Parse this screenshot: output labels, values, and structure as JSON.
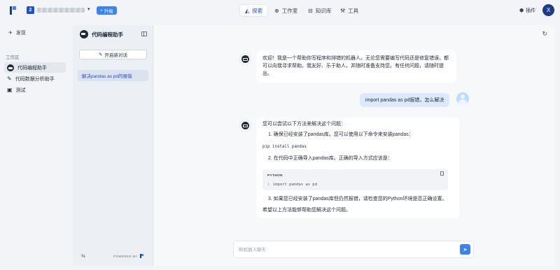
{
  "topbar": {
    "workspace_badge": "2",
    "upgrade_label": "升级",
    "tabs": [
      {
        "label": "探索",
        "icon": "explore-icon",
        "active": true
      },
      {
        "label": "工作室",
        "icon": "studio-icon",
        "active": false
      },
      {
        "label": "知识库",
        "icon": "knowledge-icon",
        "active": false
      },
      {
        "label": "工具",
        "icon": "tools-icon",
        "active": false
      }
    ],
    "plugin_label": "插件",
    "avatar_letter": "X"
  },
  "sidebar": {
    "discover_label": "发现",
    "section_label": "工作区",
    "items": [
      {
        "label": "代码编程助手",
        "active": true
      },
      {
        "label": "代码数据分析助手",
        "active": false
      },
      {
        "label": "测试",
        "active": false
      }
    ]
  },
  "panel": {
    "title": "代码编程助手",
    "new_chat_label": "开启新对话",
    "conversations": [
      "解决pandas as pd的报错"
    ],
    "powered_by": "POWERED BY"
  },
  "chat": {
    "messages": [
      {
        "role": "assistant",
        "text": "欢迎！我是一个帮助你写程序和排错的机器人。无论您需要编写代码还是修复错误，都可以向我寻求帮助。我友好、乐于助人，并随时准备支持您。有任何问题，请随时提出。"
      },
      {
        "role": "user",
        "text": "import pandas as pd报错，怎么解决"
      },
      {
        "role": "assistant",
        "intro": "您可以尝试以下方法来解决这个问题：",
        "step1": "1. 确保已经安装了pandas库。您可以使用以下命令来安装pandas：",
        "cmd": "pip install pandas",
        "step2": "2. 在代码中正确导入pandas库。正确的导入方式应该是：",
        "code_lang": "PYTHON",
        "code_line_no": "1",
        "code": "import pandas as pd",
        "step3": "3. 如果您已经安装了pandas库但仍然报错，请检查您的Python环境是否正确设置。",
        "closing": "希望以上方法能够帮助您解决这个问题。"
      }
    ],
    "input_placeholder": "和机器人聊天"
  },
  "colors": {
    "accent": "#3b82f6",
    "brand_dark": "#1e3a8a",
    "user_bubble": "#dbeafe"
  }
}
